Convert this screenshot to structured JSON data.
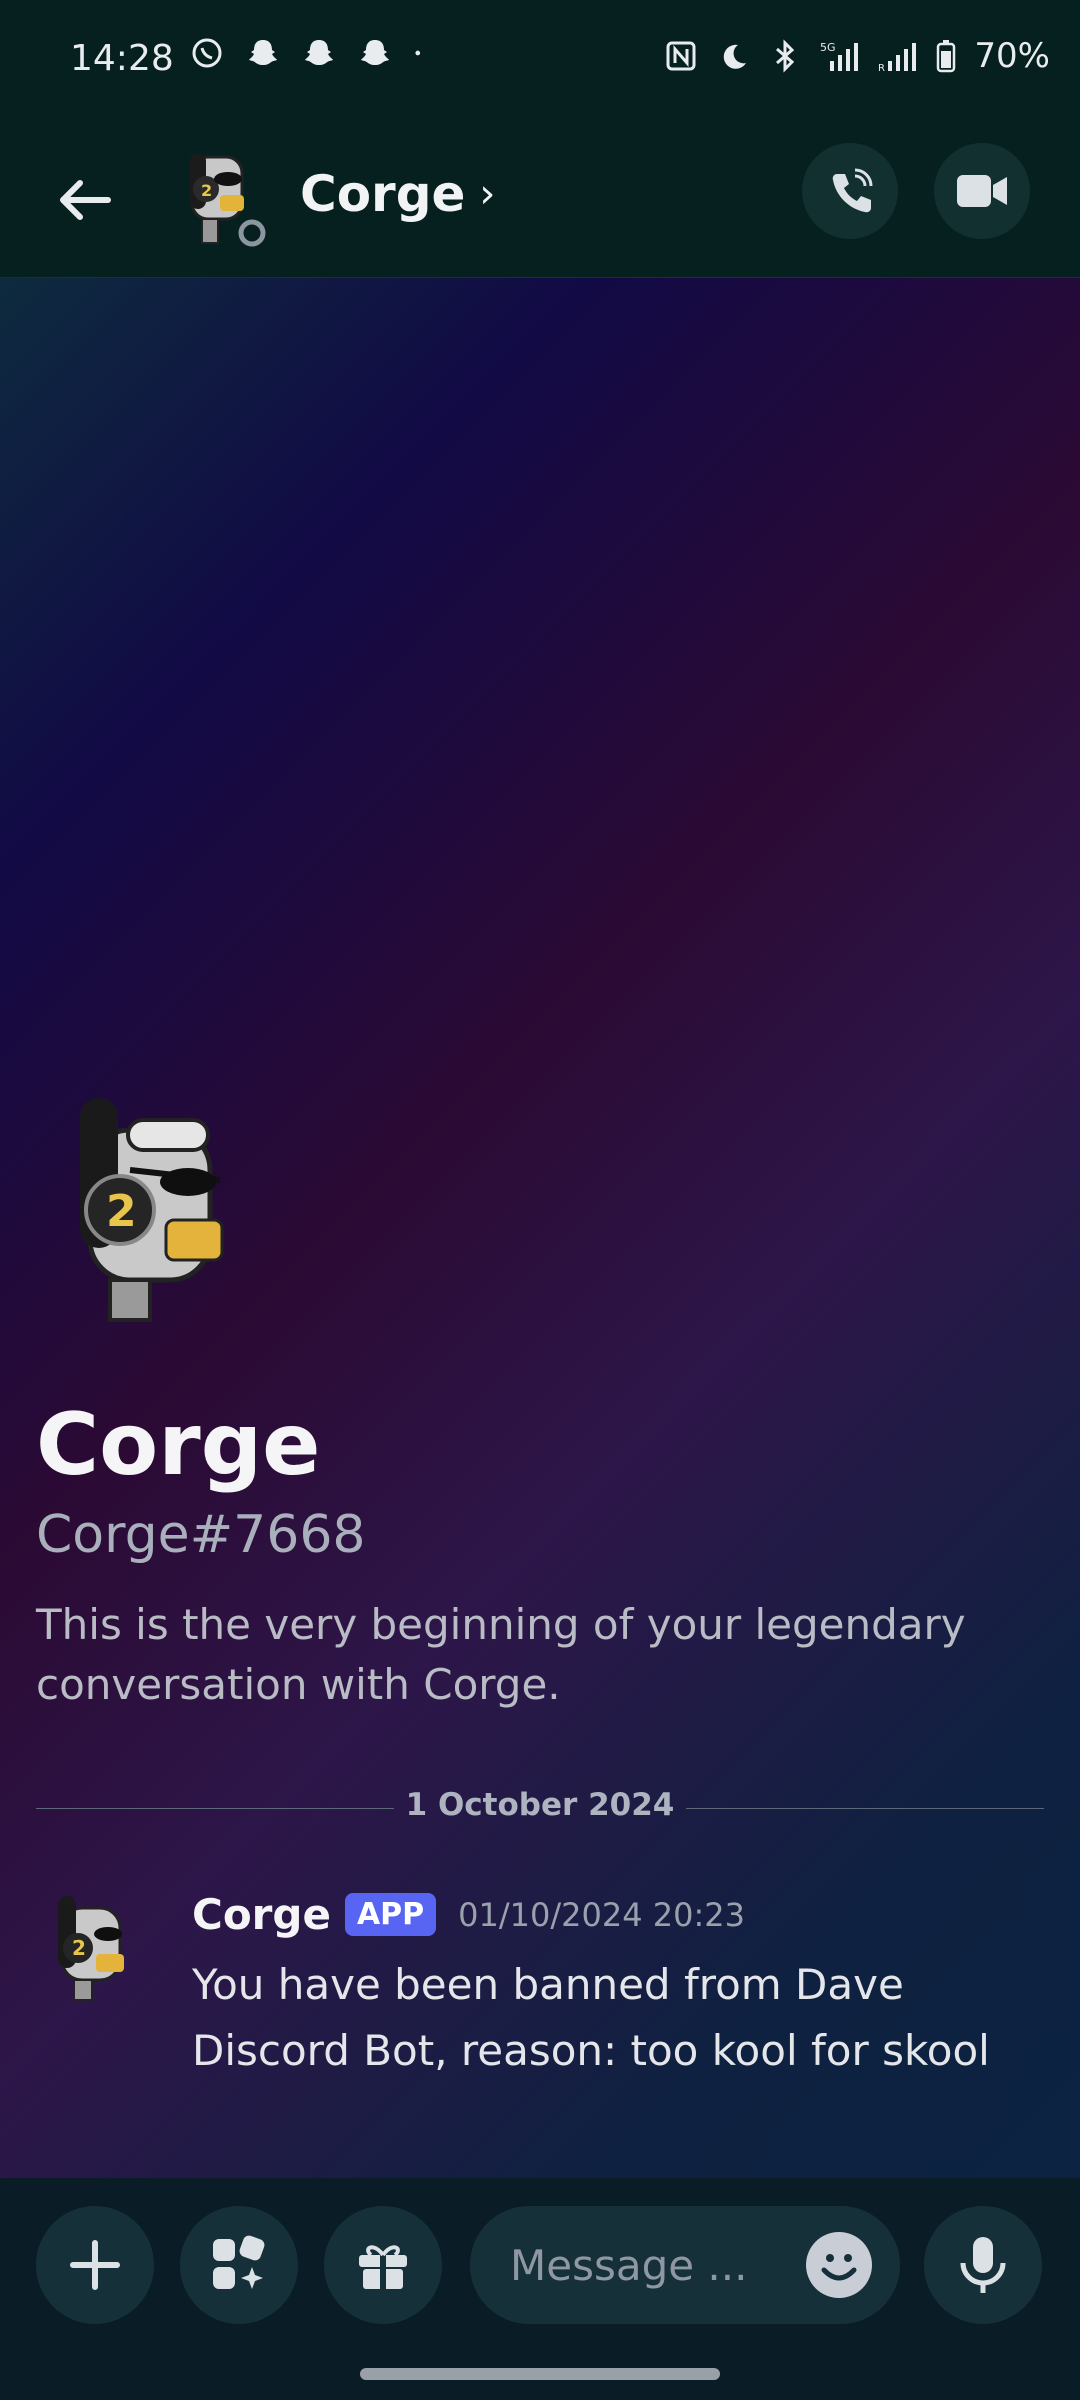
{
  "status_bar": {
    "time": "14:28",
    "battery": "70%",
    "network": "5G",
    "icons_left": [
      "whatsapp-icon",
      "snapchat-icon",
      "snapchat-icon",
      "snapchat-icon",
      "dot-icon"
    ],
    "icons_right": [
      "nfc-icon",
      "moon-icon",
      "bluetooth-icon",
      "signal-icon",
      "signal-icon",
      "battery-icon"
    ]
  },
  "header": {
    "title": "Corge",
    "chevron": "›"
  },
  "profile": {
    "name": "Corge",
    "tag": "Corge#7668",
    "description": "This is the very beginning of your legendary conversation with Corge."
  },
  "divider": {
    "date": "1 October 2024"
  },
  "message": {
    "author": "Corge",
    "badge": "APP",
    "timestamp": "01/10/2024 20:23",
    "text": "You have been banned from Dave Discord Bot, reason: too kool for skool"
  },
  "composer": {
    "placeholder": "Message ..."
  },
  "colors": {
    "header_bg": "#05201f",
    "badge": "#5865f2",
    "composer_bg": "#0a1d27"
  }
}
